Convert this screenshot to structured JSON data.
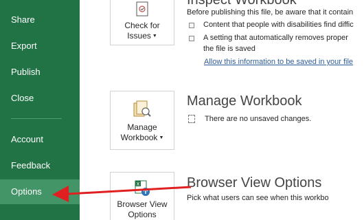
{
  "colors": {
    "sidebar_bg": "#217346",
    "sidebar_active": "#439467",
    "link": "#2e5c9a",
    "arrow": "#e02020"
  },
  "sidebar": {
    "items": [
      {
        "label": "Share"
      },
      {
        "label": "Export"
      },
      {
        "label": "Publish"
      },
      {
        "label": "Close"
      },
      {
        "label": "Account"
      },
      {
        "label": "Feedback"
      },
      {
        "label": "Options",
        "active": true
      }
    ]
  },
  "inspect": {
    "title": "Inspect Workbook",
    "tile_label_1": "Check for",
    "tile_label_2": "Issues",
    "intro": "Before publishing this file, be aware that it contain",
    "bullet1": "Content that people with disabilities find diffic",
    "bullet2_line1": "A setting that automatically removes proper",
    "bullet2_line2": "the file is saved",
    "link": "Allow this information to be saved in your file"
  },
  "manage": {
    "title": "Manage Workbook",
    "tile_label_1": "Manage",
    "tile_label_2": "Workbook",
    "status": "There are no unsaved changes."
  },
  "browser": {
    "title": "Browser View Options",
    "tile_label_1": "Browser View",
    "tile_label_2": "Options",
    "desc": "Pick what users can see when this workbo"
  }
}
